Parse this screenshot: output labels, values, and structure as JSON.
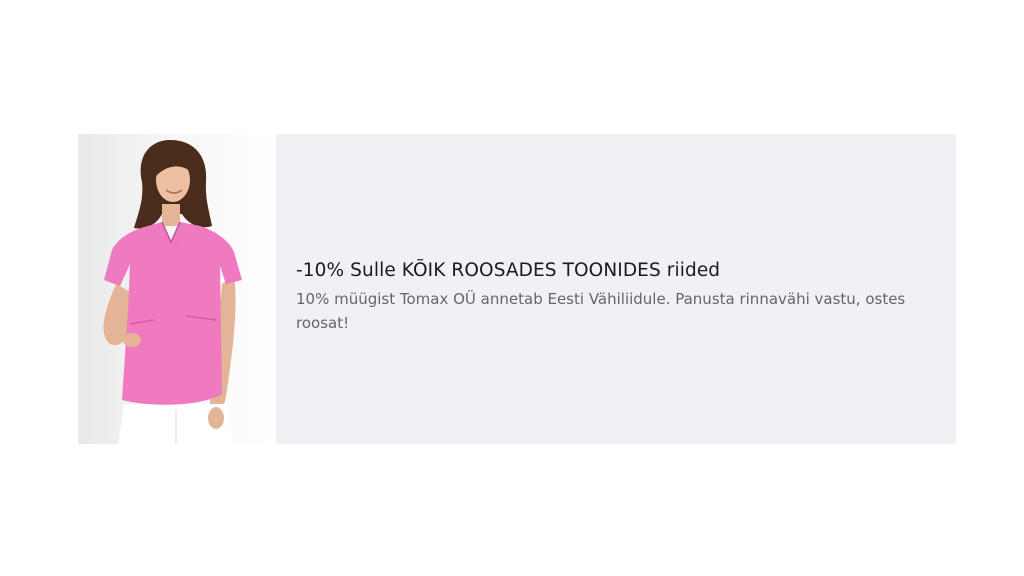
{
  "promo": {
    "headline": "-10% Sulle KÕIK ROOSADES TOONIDES riided",
    "description": "10% müügist Tomax OÜ annetab Eesti Vähiliidule. Panusta rinnavähi vastu, ostes roosat!"
  },
  "colors": {
    "panel_background": "#f0f1f4",
    "tunic_pink": "#f07ac0",
    "headline_text": "#1b1b1b",
    "description_text": "#666666"
  }
}
